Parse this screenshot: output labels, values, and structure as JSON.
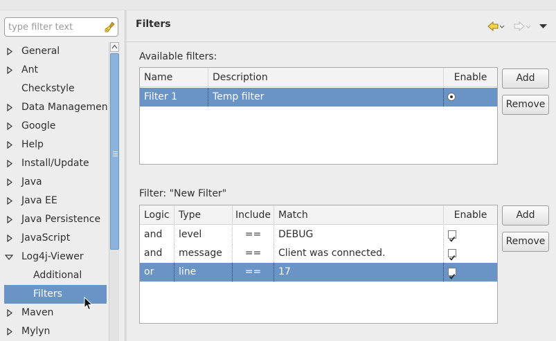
{
  "sidebar": {
    "filter_placeholder": "type filter text",
    "items": [
      {
        "label": "General",
        "expandable": true
      },
      {
        "label": "Ant",
        "expandable": true
      },
      {
        "label": "Checkstyle",
        "expandable": false
      },
      {
        "label": "Data Management",
        "expandable": true
      },
      {
        "label": "Google",
        "expandable": true
      },
      {
        "label": "Help",
        "expandable": true
      },
      {
        "label": "Install/Update",
        "expandable": true
      },
      {
        "label": "Java",
        "expandable": true
      },
      {
        "label": "Java EE",
        "expandable": true
      },
      {
        "label": "Java Persistence",
        "expandable": true
      },
      {
        "label": "JavaScript",
        "expandable": true
      },
      {
        "label": "Log4j-Viewer",
        "expanded": true
      },
      {
        "label": "Additional",
        "child": true
      },
      {
        "label": "Filters",
        "child": true,
        "selected": true
      },
      {
        "label": "Maven",
        "expandable": true
      },
      {
        "label": "Mylyn",
        "expandable": true
      }
    ]
  },
  "page": {
    "title": "Filters"
  },
  "available_filters": {
    "label": "Available filters:",
    "columns": [
      "Name",
      "Description",
      "Enable"
    ],
    "rows": [
      {
        "name": "Filter 1",
        "description": "Temp filter",
        "enabled": true,
        "selected": true
      }
    ],
    "add_label": "Add",
    "remove_label": "Remove"
  },
  "filter_rules": {
    "label": "Filter: \"New Filter\"",
    "columns": [
      "Logic",
      "Type",
      "Include",
      "Match",
      "Enable"
    ],
    "rows": [
      {
        "logic": "and",
        "type": "level",
        "include": "==",
        "match": "DEBUG",
        "enabled": true,
        "selected": false
      },
      {
        "logic": "and",
        "type": "message",
        "include": "==",
        "match": "Client was connected.",
        "enabled": true,
        "selected": false
      },
      {
        "logic": "or",
        "type": "line",
        "include": "==",
        "match": "17",
        "enabled": true,
        "selected": true
      }
    ],
    "add_label": "Add",
    "remove_label": "Remove"
  },
  "colors": {
    "selection": "#6a93c6",
    "scroll_thumb": "#8cb2de",
    "nav_arrow": "#e8c440"
  }
}
